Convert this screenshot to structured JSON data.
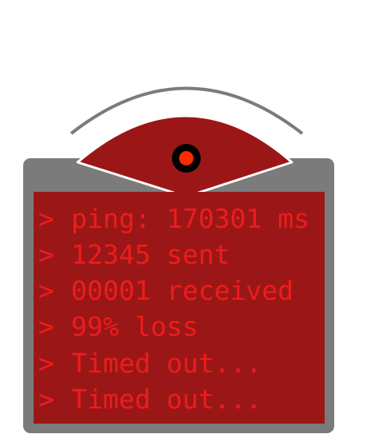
{
  "colors": {
    "frame": "#7b7b7b",
    "screen": "#9b1717",
    "text": "#ee1c1c",
    "eye_outline": "#ffffff",
    "pupil_ring": "#000000",
    "pupil": "#ff2a00",
    "signal_arc": "#7b7b7b"
  },
  "icons": {
    "eye": "eye-icon",
    "signal": "signal-arc-icon"
  },
  "terminal": {
    "lines": [
      {
        "prompt": ">",
        "text": "ping: 170301 ms"
      },
      {
        "prompt": ">",
        "text": "12345 sent"
      },
      {
        "prompt": ">",
        "text": "00001 received"
      },
      {
        "prompt": ">",
        "text": "99% loss"
      },
      {
        "prompt": ">",
        "text": "Timed out..."
      },
      {
        "prompt": ">",
        "text": "Timed out..."
      }
    ]
  }
}
